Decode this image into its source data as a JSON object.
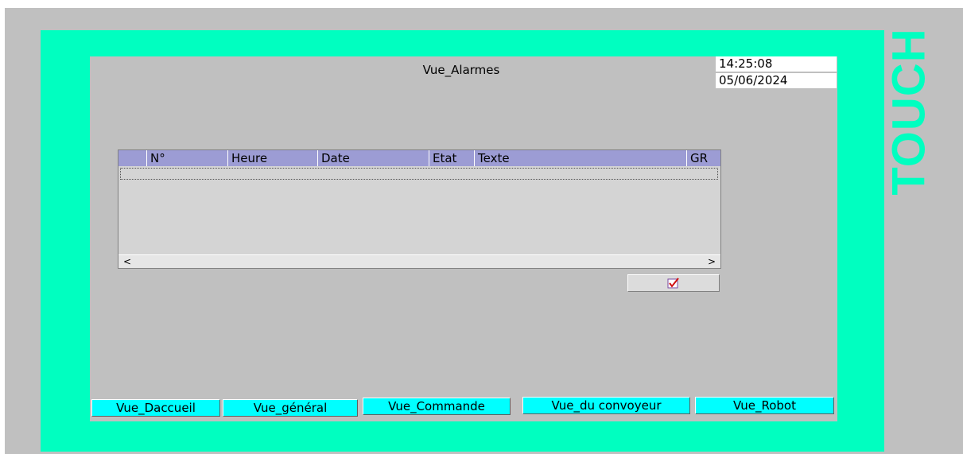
{
  "brand": "TOUCH",
  "screen_title": "Vue_Alarmes",
  "clock": {
    "time": "14:25:08",
    "date": "05/06/2024"
  },
  "alarm_table": {
    "columns": [
      "",
      "N°",
      "Heure",
      "Date",
      "Etat",
      "Texte",
      "GR"
    ],
    "rows": [],
    "scroll_left": "<",
    "scroll_right": ">"
  },
  "acknowledge_icon": "checkmark-icon",
  "nav": {
    "accueil": "Vue_Daccueil",
    "general": "Vue_général",
    "commande": "Vue_Commande",
    "convoyeur": "Vue_du convoyeur",
    "robot": "Vue_Robot"
  },
  "colors": {
    "bezel": "#00ffc0",
    "screen_bg": "#c0c0c0",
    "table_header": "#9c9cd4",
    "nav_button": "#00ffff"
  }
}
